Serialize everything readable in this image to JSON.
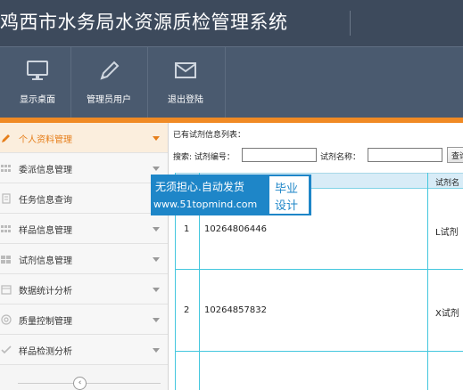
{
  "header": {
    "title": "鸡西市水务局水资源质检管理系统"
  },
  "toolbar": [
    {
      "label": "显示桌面",
      "icon": "monitor-icon"
    },
    {
      "label": "管理员用户",
      "icon": "pencil-icon"
    },
    {
      "label": "退出登陆",
      "icon": "envelope-icon"
    }
  ],
  "sidebar": {
    "items": [
      {
        "label": "个人资料管理",
        "active": true
      },
      {
        "label": "委派信息管理"
      },
      {
        "label": "任务信息查询"
      },
      {
        "label": "样品信息管理"
      },
      {
        "label": "试剂信息管理"
      },
      {
        "label": "数据统计分析"
      },
      {
        "label": "质量控制管理"
      },
      {
        "label": "样品检测分析"
      }
    ],
    "collapse_symbol": "‹"
  },
  "main": {
    "list_title": "已有试剂信息列表：",
    "search": {
      "prefix": "搜索: 试剂编号：",
      "name_label": "试剂名称：",
      "button_label": "查询",
      "code_value": "",
      "name_value": ""
    },
    "table": {
      "headers": [
        "试剂名"
      ],
      "rows": [
        {
          "index": "1",
          "code": "10264806446",
          "name": "L试剂"
        },
        {
          "index": "2",
          "code": "10264857832",
          "name": "X试剂"
        }
      ]
    }
  },
  "watermark": {
    "line1": "无须担心.自动发货",
    "line2": "www.51topmind.com",
    "box_line1": "毕业",
    "box_line2": "设计"
  },
  "colors": {
    "header": "#3d4a5c",
    "toolbar": "#4a5a6f",
    "accent": "#f08a24",
    "grid": "#44c7de",
    "watermark": "#1e86c8"
  }
}
